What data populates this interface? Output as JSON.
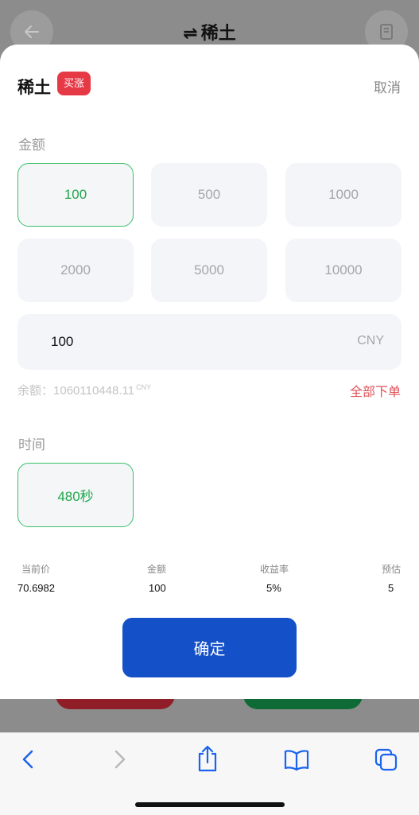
{
  "background": {
    "title": "稀土",
    "swap_glyph": "⇌"
  },
  "sheet": {
    "title": "稀土",
    "badge": "买涨",
    "cancel": "取消",
    "amount_label": "金额",
    "amount_options": [
      "100",
      "500",
      "1000",
      "2000",
      "5000",
      "10000"
    ],
    "selected_amount": "100",
    "amount_input_value": "100",
    "amount_unit": "CNY",
    "balance_label": "余额：",
    "balance_value": "1060110448.11",
    "balance_unit": "CNY",
    "all_in": "全部下单",
    "time_label": "时间",
    "time_option": "480秒",
    "summary": {
      "headers": [
        "当前价",
        "金额",
        "收益率",
        "预估"
      ],
      "values": [
        "70.6982",
        "100",
        "5%",
        "5"
      ]
    },
    "confirm": "确定"
  },
  "colors": {
    "accent_green": "#21a74c",
    "confirm_blue": "#1450c8",
    "badge_red": "#e63946",
    "all_in_red": "#e0525a"
  },
  "icons": {
    "back": "arrow-left-icon",
    "record": "document-icon",
    "browser_back": "chevron-left-icon",
    "browser_forward": "chevron-right-icon",
    "share": "share-icon",
    "bookmarks": "book-icon",
    "tabs": "tabs-icon"
  }
}
